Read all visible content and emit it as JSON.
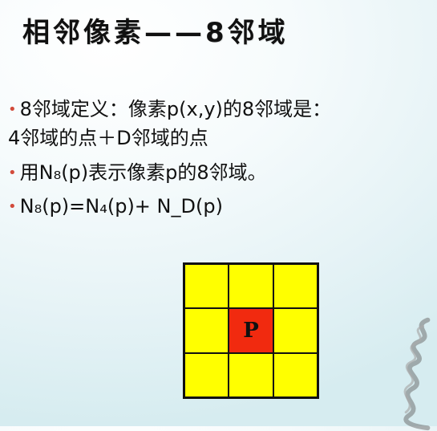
{
  "title": "相邻像素——8邻域",
  "bullets": {
    "b1_line1": "8邻域定义：像素p(x,y)的8邻域是：",
    "b1_line2": "4邻域的点＋D邻域的点",
    "b2": "用N₈(p)表示像素p的8邻域。",
    "b3": "N₈(p)=N₄(p)+ N_D(p)"
  },
  "grid": {
    "center_label": "P",
    "cell_colors": {
      "neighbor": "#ffff00",
      "center": "#f12a0f"
    }
  },
  "colors": {
    "bullet": "#d24b3b",
    "text": "#111111"
  }
}
